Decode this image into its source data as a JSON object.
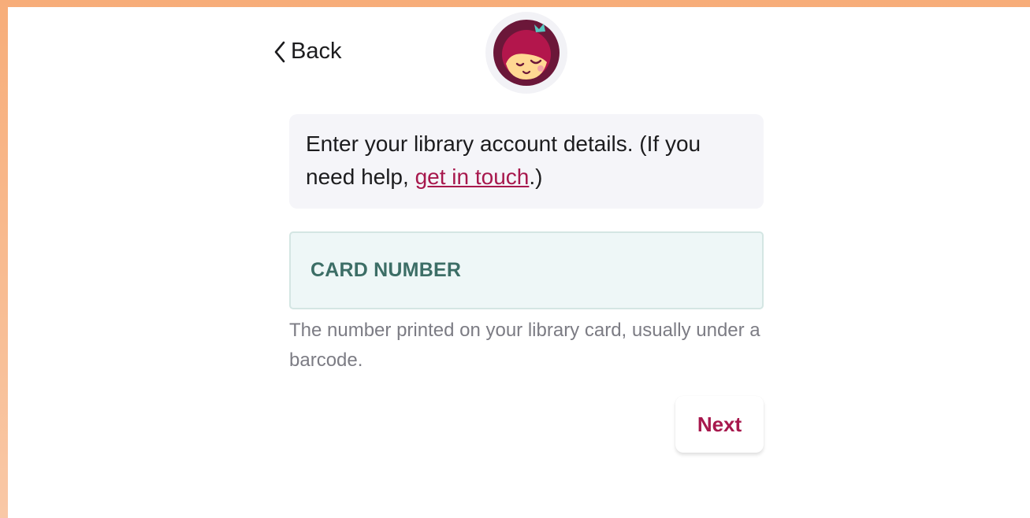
{
  "nav": {
    "back_label": "Back"
  },
  "logo": {
    "icon": "libby-logo-icon",
    "colors": {
      "ring": "#6b1739",
      "hair": "#b3164c",
      "face": "#ffd892",
      "ribbon": "#58c7c0"
    }
  },
  "intro": {
    "text_before": "Enter your library account details. (If you need help, ",
    "link_label": "get in touch",
    "text_after": ".)"
  },
  "card_field": {
    "label": "CARD NUMBER",
    "value": ""
  },
  "hint": "The number printed on your library card, usually under a barcode.",
  "actions": {
    "next_label": "Next"
  },
  "colors": {
    "accent": "#a7184d",
    "field_bg": "#eef7f7",
    "field_label": "#3c6e66"
  }
}
